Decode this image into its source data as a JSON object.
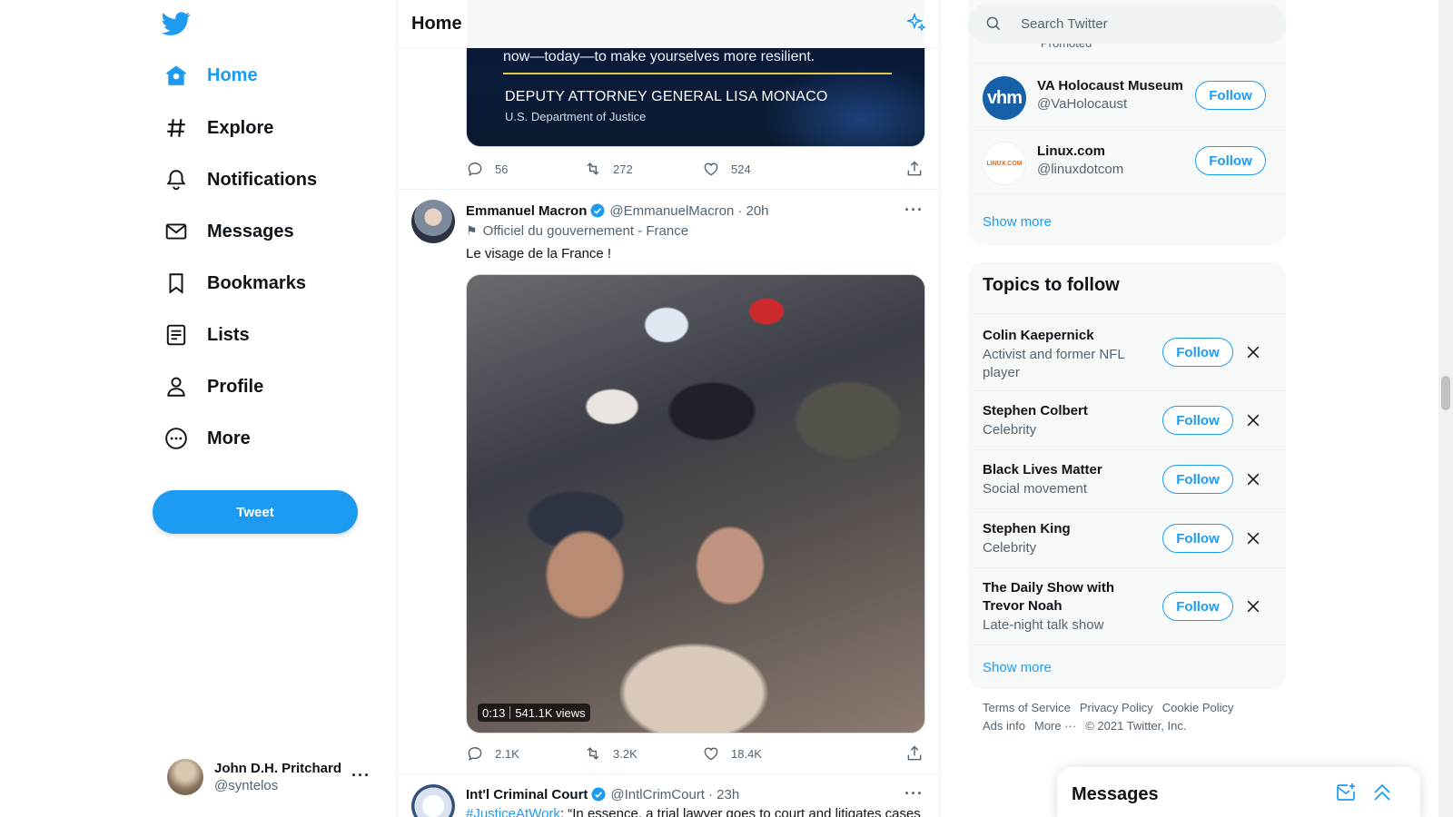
{
  "nav": {
    "items": [
      {
        "label": "Home"
      },
      {
        "label": "Explore"
      },
      {
        "label": "Notifications"
      },
      {
        "label": "Messages"
      },
      {
        "label": "Bookmarks"
      },
      {
        "label": "Lists"
      },
      {
        "label": "Profile"
      },
      {
        "label": "More"
      }
    ],
    "tweet_button": "Tweet"
  },
  "account": {
    "name": "John D.H. Pritchard",
    "handle": "@syntelos",
    "more": "···"
  },
  "center": {
    "title": "Home",
    "tweets": [
      {
        "media_quote": "now—today—to make yourselves more resilient.",
        "media_speaker": "DEPUTY ATTORNEY GENERAL LISA MONACO",
        "media_dept": "U.S. Department of Justice",
        "replies": "56",
        "retweets": "272",
        "likes": "524"
      },
      {
        "name": "Emmanuel Macron",
        "handle": "@EmmanuelMacron",
        "time": "· 20h",
        "label": "Officiel du gouvernement - France",
        "text": "Le visage de la France !",
        "video_time": "0:13",
        "video_views": "541.1K views",
        "replies": "2.1K",
        "retweets": "3.2K",
        "likes": "18.4K"
      },
      {
        "name": "Int'l Criminal Court",
        "handle": "@IntlCrimCourt",
        "time": "· 23h",
        "text_link": "#JusticeAtWork",
        "text_rest": ": “In essence, a trial lawyer goes to court and litigates cases"
      }
    ],
    "more_dots": "···"
  },
  "search": {
    "placeholder": "Search Twitter"
  },
  "who_to_follow": {
    "promoted_label": "Promoted",
    "accounts": [
      {
        "name": "VA Holocaust Museum",
        "handle": "@VaHolocaust",
        "button": "Follow",
        "logo_text": "vhm"
      },
      {
        "name": "Linux.com",
        "handle": "@linuxdotcom",
        "button": "Follow",
        "logo_text": "LINUX.COM"
      }
    ],
    "show_more": "Show more"
  },
  "topics": {
    "title": "Topics to follow",
    "items": [
      {
        "name": "Colin Kaepernick",
        "sub1": "Activist and former NFL",
        "sub2": "player",
        "button": "Follow"
      },
      {
        "name": "Stephen Colbert",
        "sub1": "Celebrity",
        "button": "Follow"
      },
      {
        "name": "Black Lives Matter",
        "sub1": "Social movement",
        "button": "Follow"
      },
      {
        "name": "Stephen King",
        "sub1": "Celebrity",
        "button": "Follow"
      },
      {
        "name": "The Daily Show with",
        "name2": "Trevor Noah",
        "sub1": "Late-night talk show",
        "button": "Follow"
      }
    ],
    "show_more": "Show more"
  },
  "footer": {
    "links": [
      "Terms of Service",
      "Privacy Policy",
      "Cookie Policy",
      "Ads info",
      "More ···",
      "© 2021 Twitter, Inc."
    ]
  },
  "messages_dock": {
    "title": "Messages"
  },
  "colors": {
    "accent": "#1d9bf0",
    "text": "#0f1419",
    "secondary": "#536471"
  }
}
